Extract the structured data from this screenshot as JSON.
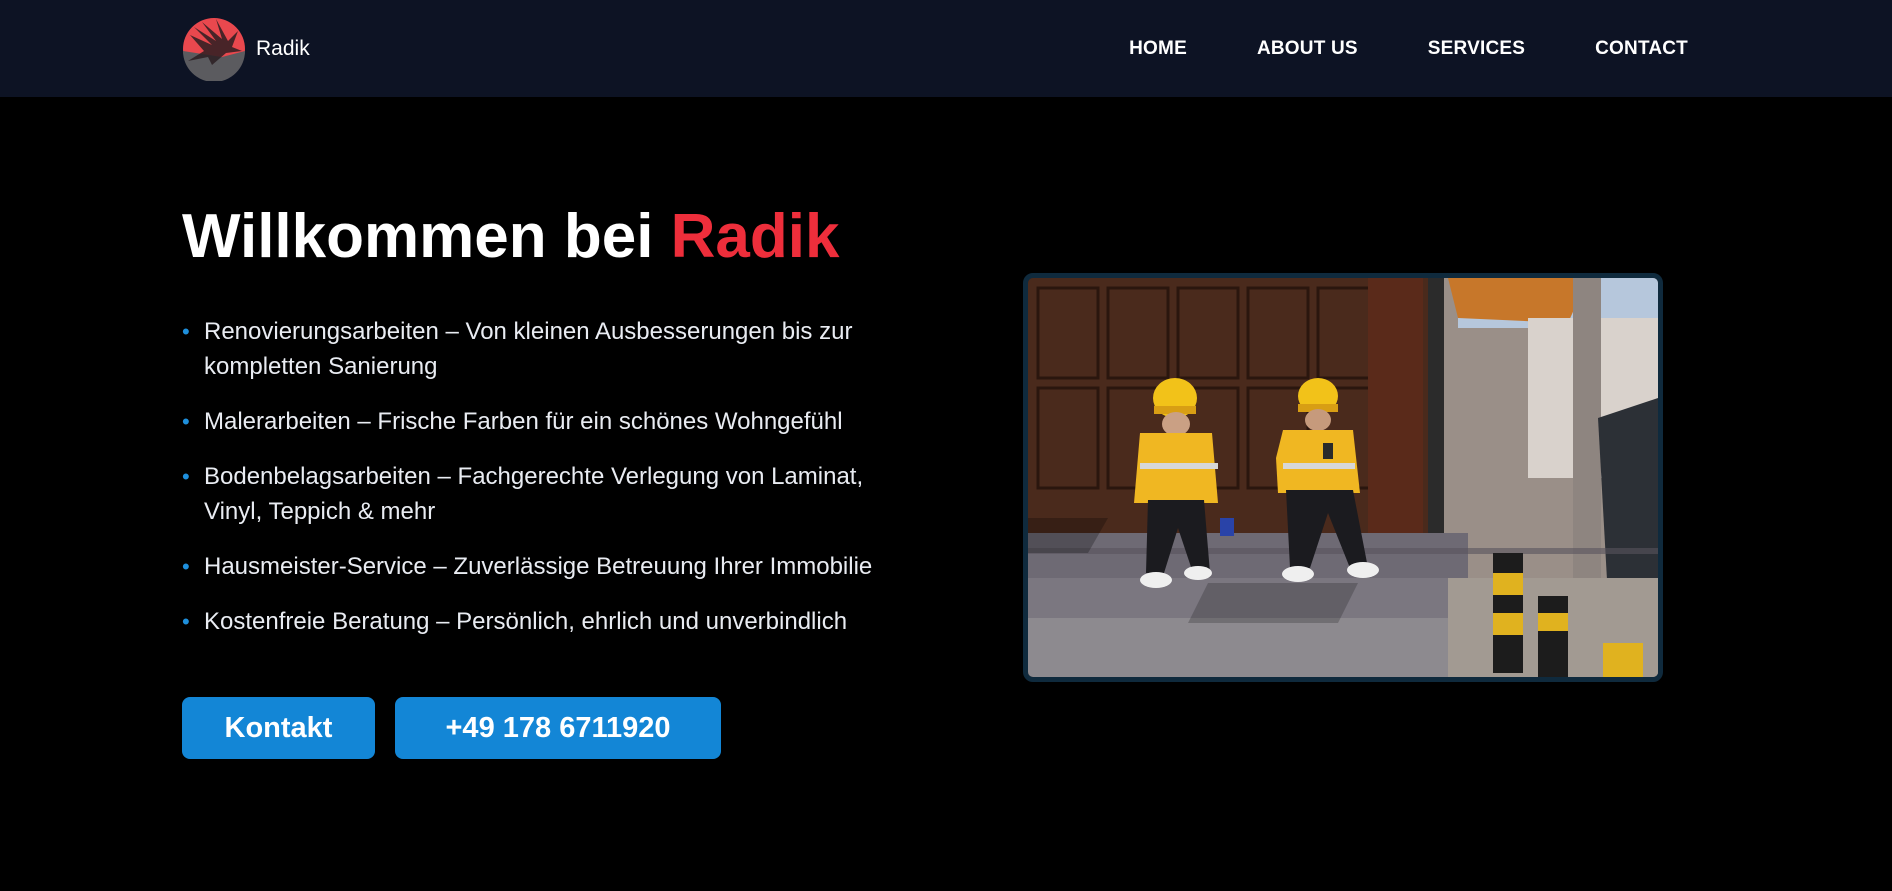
{
  "nav": {
    "brand": "Radik",
    "logo_icon": "eagle-logo-icon",
    "items": [
      {
        "label": "HOME"
      },
      {
        "label": "ABOUT US"
      },
      {
        "label": "SERVICES"
      },
      {
        "label": "CONTACT"
      }
    ]
  },
  "hero": {
    "title_prefix": "Willkommen bei ",
    "title_accent": "Radik",
    "features": [
      "Renovierungsarbeiten – Von kleinen Ausbesserungen bis zur kompletten Sanierung",
      "Malerarbeiten – Frische Farben für ein schönes Wohngefühl",
      "Bodenbelagsarbeiten – Fachgerechte Verlegung von Laminat, Vinyl, Teppich & mehr",
      "Hausmeister-Service – Zuverlässige Betreuung Ihrer Immobilie",
      "Kostenfreie Beratung – Persönlich, ehrlich und unverbindlich"
    ],
    "bullet": "•",
    "buttons": {
      "contact": "Kontakt",
      "phone": "+49 178 6711920"
    },
    "image_icon": "workers-photo"
  },
  "colors": {
    "nav_bg": "#0d1324",
    "page_bg": "#000000",
    "accent": "#ee2e3b",
    "button": "#1386d6",
    "bullet": "#1e8fdc"
  }
}
